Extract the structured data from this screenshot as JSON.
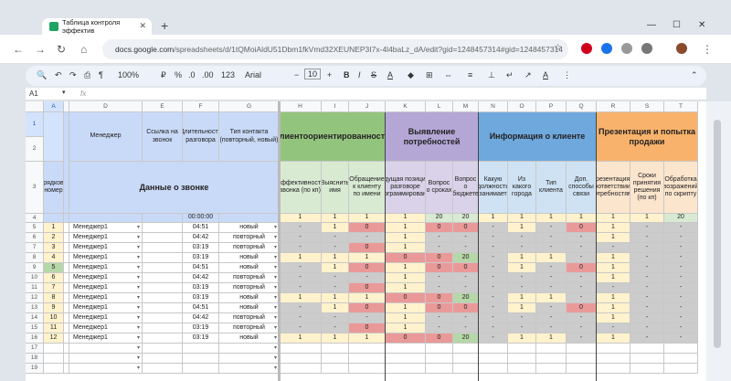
{
  "browser": {
    "tab_title": "Таблица контроля эффектив",
    "url_host": "docs.google.com",
    "url_path": "/spreadsheets/d/1tQMoiAldU51Dbm1fkVmd32XEUNEP3I7x-4l4baLz_dA/edit?gid=1248457314#gid=1248457314"
  },
  "toolbar": {
    "zoom": "100%",
    "fmt_pct": "%",
    "fmt_dec0": ".0",
    "fmt_dec00": ".00",
    "fmt_num": "123",
    "font": "Arial",
    "size": "10"
  },
  "formula": {
    "cell": "A1",
    "fx": "fx"
  },
  "cols": [
    {
      "l": "A",
      "w": 22
    },
    {
      "l": "",
      "w": 6
    },
    {
      "l": "D",
      "w": 80
    },
    {
      "l": "E",
      "w": 44
    },
    {
      "l": "F",
      "w": 40
    },
    {
      "l": "G",
      "w": 66
    },
    {
      "l": "H",
      "w": 46
    },
    {
      "l": "I",
      "w": 30
    },
    {
      "l": "J",
      "w": 40
    },
    {
      "l": "K",
      "w": 44
    },
    {
      "l": "L",
      "w": 30
    },
    {
      "l": "M",
      "w": 28
    },
    {
      "l": "N",
      "w": 32
    },
    {
      "l": "O",
      "w": 31
    },
    {
      "l": "P",
      "w": 33
    },
    {
      "l": "Q",
      "w": 33
    },
    {
      "l": "R",
      "w": 37
    },
    {
      "l": "S",
      "w": 37
    },
    {
      "l": "T",
      "w": 37
    }
  ],
  "headers": {
    "nomer": "Порядковый номер",
    "manager": "Менеджер",
    "link": "Ссылка на звонок",
    "duration": "Длительность разговора",
    "contact_type": "Тип контакта (повторный, новый)",
    "data_title": "Данные о звонке",
    "g1": "Клиентоориентированность",
    "g2": "Выявление потребностей",
    "g3": "Информация о клиенте",
    "g4": "Презентация и попытка продажи",
    "sub": [
      "Эффективность звонка (по кп)",
      "Выяснить имя",
      "Обращение к клиенту по имени",
      "Ведущая позиция в разговоре (программирование)",
      "Вопрос о сроках",
      "Вопрос о бюджете",
      "Какую должность занимает",
      "Из какого города",
      "Тип клиента",
      "Доп. способы связи",
      "Презентация в соответствии с потребностями",
      "Сроки принятия решения (по кп)",
      "Обработка возражений по скрипту"
    ],
    "weights": [
      "1",
      "1",
      "1",
      "1",
      "20",
      "20",
      "1",
      "1",
      "1",
      "1",
      "1",
      "1",
      "20"
    ],
    "dur_total": "00:00:00"
  },
  "row_numbers": [
    "1",
    "2",
    "3",
    "4",
    "5",
    "6",
    "7",
    "8",
    "9",
    "10",
    "11",
    "12",
    "13",
    "14",
    "15",
    "16",
    "17",
    "18",
    "19"
  ],
  "rows": [
    {
      "n": "1",
      "m": "Менеджер1",
      "t": "04:51",
      "k": "новый",
      "v": [
        "-",
        "1",
        "0",
        "1",
        "0",
        "0",
        "-",
        "1",
        "-",
        "0",
        "1",
        "-",
        "-"
      ]
    },
    {
      "n": "2",
      "m": "Менеджер1",
      "t": "04:42",
      "k": "повторный",
      "v": [
        "-",
        "-",
        "-",
        "1",
        "-",
        "-",
        "-",
        "-",
        "-",
        "-",
        "1",
        "-",
        "-"
      ]
    },
    {
      "n": "3",
      "m": "Менеджер1",
      "t": "03:19",
      "k": "повторный",
      "v": [
        "-",
        "-",
        "0",
        "1",
        "-",
        "-",
        "-",
        "-",
        "-",
        "-",
        "-",
        "-",
        "-"
      ]
    },
    {
      "n": "4",
      "m": "Менеджер1",
      "t": "03:19",
      "k": "новый",
      "v": [
        "1",
        "1",
        "1",
        "0",
        "0",
        "20",
        "-",
        "1",
        "1",
        "-",
        "1",
        "-",
        "-"
      ]
    },
    {
      "n": "5",
      "m": "Менеджер1",
      "t": "04:51",
      "k": "новый",
      "v": [
        "-",
        "1",
        "0",
        "1",
        "0",
        "0",
        "-",
        "1",
        "-",
        "0",
        "1",
        "-",
        "-"
      ]
    },
    {
      "n": "6",
      "m": "Менеджер1",
      "t": "04:42",
      "k": "повторный",
      "v": [
        "-",
        "-",
        "-",
        "1",
        "-",
        "-",
        "-",
        "-",
        "-",
        "-",
        "1",
        "-",
        "-"
      ]
    },
    {
      "n": "7",
      "m": "Менеджер1",
      "t": "03:19",
      "k": "повторный",
      "v": [
        "-",
        "-",
        "0",
        "1",
        "-",
        "-",
        "-",
        "-",
        "-",
        "-",
        "-",
        "-",
        "-"
      ]
    },
    {
      "n": "8",
      "m": "Менеджер1",
      "t": "03:19",
      "k": "новый",
      "v": [
        "1",
        "1",
        "1",
        "0",
        "0",
        "20",
        "-",
        "1",
        "1",
        "-",
        "1",
        "-",
        "-"
      ]
    },
    {
      "n": "9",
      "m": "Менеджер1",
      "t": "04:51",
      "k": "новый",
      "v": [
        "-",
        "1",
        "0",
        "1",
        "0",
        "0",
        "-",
        "1",
        "-",
        "0",
        "1",
        "-",
        "-"
      ]
    },
    {
      "n": "10",
      "m": "Менеджер1",
      "t": "04:42",
      "k": "повторный",
      "v": [
        "-",
        "-",
        "-",
        "1",
        "-",
        "-",
        "-",
        "-",
        "-",
        "-",
        "1",
        "-",
        "-"
      ]
    },
    {
      "n": "11",
      "m": "Менеджер1",
      "t": "03:19",
      "k": "повторный",
      "v": [
        "-",
        "-",
        "0",
        "1",
        "-",
        "-",
        "-",
        "-",
        "-",
        "-",
        "-",
        "-",
        "-"
      ]
    },
    {
      "n": "12",
      "m": "Менеджер1",
      "t": "03:19",
      "k": "новый",
      "v": [
        "1",
        "1",
        "1",
        "0",
        "0",
        "20",
        "-",
        "1",
        "1",
        "-",
        "1",
        "-",
        "-"
      ]
    }
  ],
  "colors": {
    "accent": "#1a73e8",
    "sheets_green": "#1fa463",
    "group1": "#93c47d",
    "group2": "#b4a7d6",
    "group3": "#6fa8dc",
    "group4": "#f9b26b"
  }
}
